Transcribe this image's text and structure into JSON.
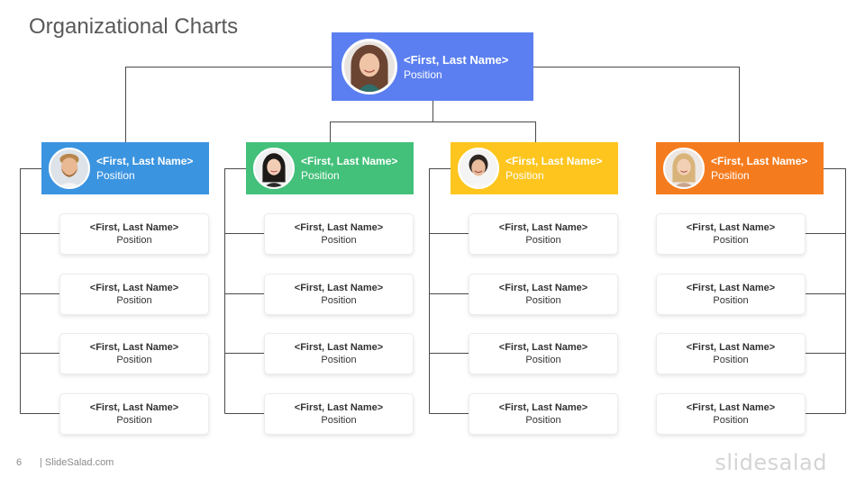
{
  "slide": {
    "title": "Organizational Charts",
    "page_number": "6",
    "site": "| SlideSalad.com",
    "brand": "slidesalad"
  },
  "top": {
    "name": "<First, Last Name>",
    "position": "Position",
    "color": "#5b7ff0",
    "avatar_icon": "woman-curly-hair-icon"
  },
  "managers": [
    {
      "name": "<First, Last Name>",
      "position": "Position",
      "color": "#3b94e0",
      "avatar_icon": "bearded-man-icon",
      "reports": [
        {
          "name": "<First, Last Name>",
          "position": "Position"
        },
        {
          "name": "<First, Last Name>",
          "position": "Position"
        },
        {
          "name": "<First, Last Name>",
          "position": "Position"
        },
        {
          "name": "<First, Last Name>",
          "position": "Position"
        }
      ]
    },
    {
      "name": "<First, Last Name>",
      "position": "Position",
      "color": "#43c07a",
      "avatar_icon": "woman-dark-hair-icon",
      "reports": [
        {
          "name": "<First, Last Name>",
          "position": "Position"
        },
        {
          "name": "<First, Last Name>",
          "position": "Position"
        },
        {
          "name": "<First, Last Name>",
          "position": "Position"
        },
        {
          "name": "<First, Last Name>",
          "position": "Position"
        }
      ]
    },
    {
      "name": "<First, Last Name>",
      "position": "Position",
      "color": "#fdc51e",
      "avatar_icon": "woman-smiling-icon",
      "reports": [
        {
          "name": "<First, Last Name>",
          "position": "Position"
        },
        {
          "name": "<First, Last Name>",
          "position": "Position"
        },
        {
          "name": "<First, Last Name>",
          "position": "Position"
        },
        {
          "name": "<First, Last Name>",
          "position": "Position"
        }
      ]
    },
    {
      "name": "<First, Last Name>",
      "position": "Position",
      "color": "#f57c1e",
      "avatar_icon": "woman-blonde-hair-icon",
      "reports": [
        {
          "name": "<First, Last Name>",
          "position": "Position"
        },
        {
          "name": "<First, Last Name>",
          "position": "Position"
        },
        {
          "name": "<First, Last Name>",
          "position": "Position"
        },
        {
          "name": "<First, Last Name>",
          "position": "Position"
        }
      ]
    }
  ]
}
